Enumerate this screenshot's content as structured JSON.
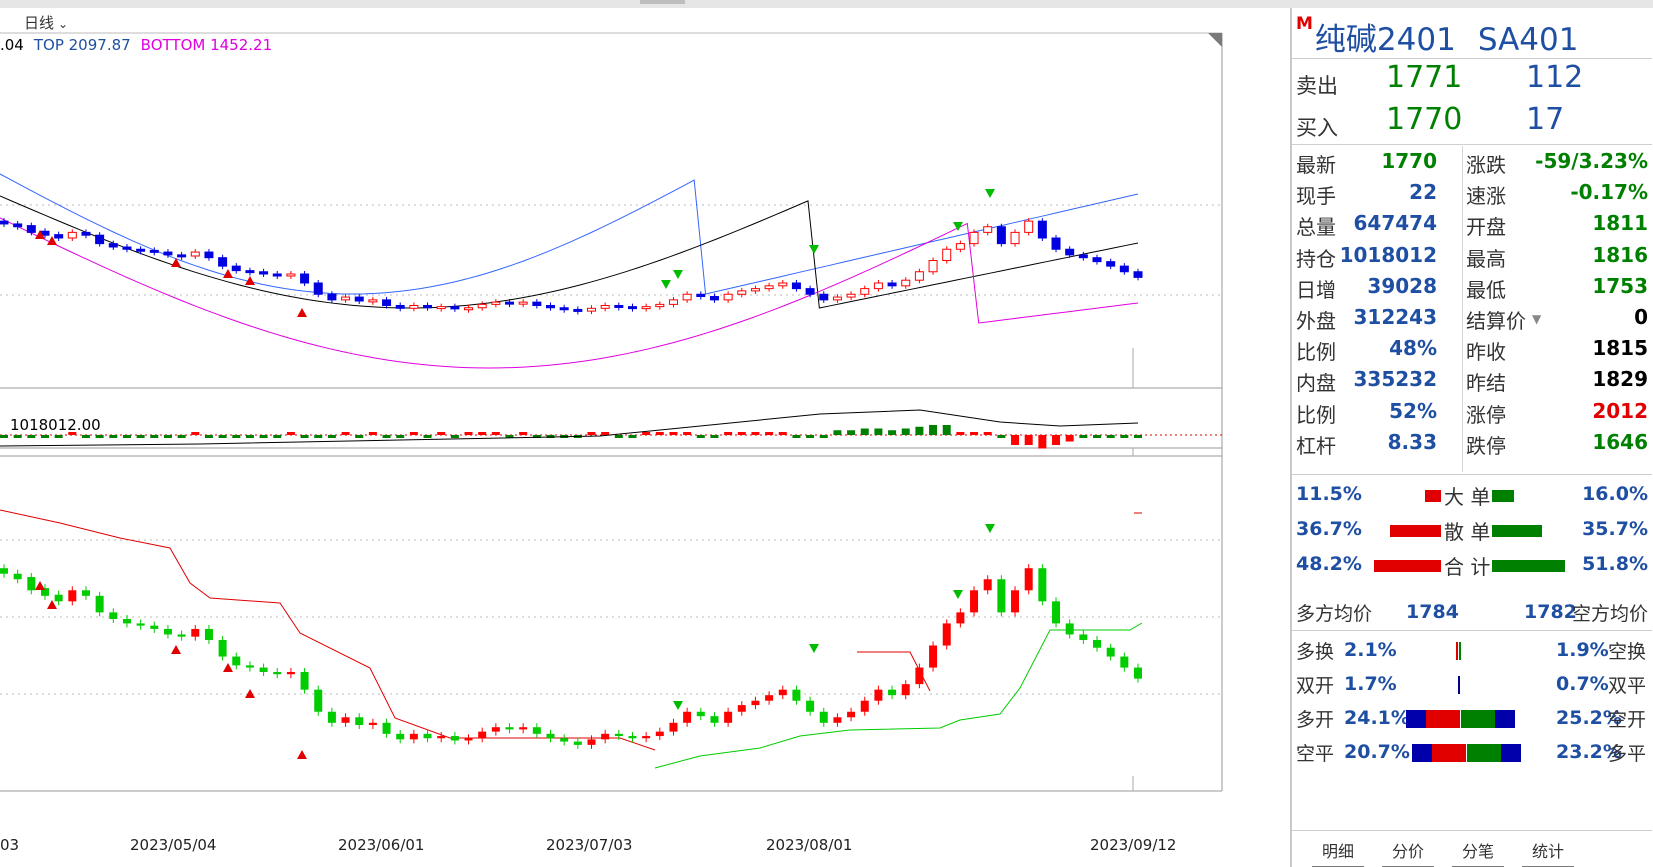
{
  "chart_header": {
    "period": "日线",
    "legend": [
      {
        "label": ".04",
        "color": "#000000"
      },
      {
        "label": "TOP 2097.87",
        "color": "#1f4fa3"
      },
      {
        "label": "BOTTOM 1452.21",
        "color": "#e000e0"
      }
    ],
    "volume_label": "1018012.00"
  },
  "x_axis_labels": [
    "03",
    "2023/05/04",
    "2023/06/01",
    "2023/07/03",
    "2023/08/01",
    "2023/09/12"
  ],
  "chart_data": [
    {
      "type": "candlestick",
      "panel": "price",
      "note_series": [
        "upper band",
        "middle band",
        "lower band"
      ],
      "candles_open_close": [
        [
          1930,
          1925
        ],
        [
          1925,
          1920
        ],
        [
          1922,
          1910
        ],
        [
          1912,
          1905
        ],
        [
          1906,
          1900
        ],
        [
          1900,
          1910
        ],
        [
          1910,
          1905
        ],
        [
          1905,
          1890
        ],
        [
          1890,
          1884
        ],
        [
          1884,
          1880
        ],
        [
          1880,
          1878
        ],
        [
          1878,
          1875
        ],
        [
          1875,
          1870
        ],
        [
          1870,
          1868
        ],
        [
          1868,
          1875
        ],
        [
          1875,
          1865
        ],
        [
          1865,
          1850
        ],
        [
          1850,
          1842
        ],
        [
          1842,
          1840
        ],
        [
          1840,
          1836
        ],
        [
          1836,
          1834
        ],
        [
          1834,
          1836
        ],
        [
          1836,
          1820
        ],
        [
          1820,
          1800
        ],
        [
          1800,
          1790
        ],
        [
          1790,
          1795
        ],
        [
          1795,
          1788
        ],
        [
          1788,
          1790
        ],
        [
          1790,
          1780
        ],
        [
          1780,
          1775
        ],
        [
          1775,
          1780
        ],
        [
          1780,
          1776
        ],
        [
          1776,
          1778
        ],
        [
          1778,
          1774
        ],
        [
          1774,
          1776
        ],
        [
          1776,
          1782
        ],
        [
          1782,
          1786
        ],
        [
          1786,
          1784
        ],
        [
          1784,
          1786
        ],
        [
          1786,
          1780
        ],
        [
          1780,
          1776
        ],
        [
          1776,
          1773
        ],
        [
          1773,
          1770
        ],
        [
          1770,
          1775
        ],
        [
          1775,
          1780
        ],
        [
          1780,
          1778
        ],
        [
          1778,
          1776
        ],
        [
          1776,
          1778
        ],
        [
          1778,
          1782
        ],
        [
          1782,
          1790
        ],
        [
          1790,
          1800
        ],
        [
          1800,
          1796
        ],
        [
          1796,
          1790
        ],
        [
          1790,
          1800
        ],
        [
          1800,
          1806
        ],
        [
          1806,
          1810
        ],
        [
          1810,
          1815
        ],
        [
          1815,
          1820
        ],
        [
          1820,
          1810
        ],
        [
          1810,
          1800
        ],
        [
          1800,
          1790
        ],
        [
          1790,
          1795
        ],
        [
          1795,
          1800
        ],
        [
          1800,
          1810
        ],
        [
          1810,
          1820
        ],
        [
          1820,
          1815
        ],
        [
          1815,
          1825
        ],
        [
          1825,
          1840
        ],
        [
          1840,
          1860
        ],
        [
          1860,
          1880
        ],
        [
          1880,
          1890
        ],
        [
          1890,
          1910
        ],
        [
          1910,
          1920
        ],
        [
          1920,
          1890
        ],
        [
          1890,
          1910
        ],
        [
          1910,
          1930
        ],
        [
          1930,
          1900
        ],
        [
          1900,
          1880
        ],
        [
          1880,
          1870
        ],
        [
          1870,
          1865
        ],
        [
          1865,
          1858
        ],
        [
          1858,
          1850
        ],
        [
          1850,
          1840
        ],
        [
          1840,
          1830
        ]
      ]
    },
    {
      "type": "bar",
      "panel": "open-interest"
    },
    {
      "type": "candlestick",
      "panel": "indicator"
    }
  ],
  "quote": {
    "m_mark": "M",
    "name": "纯碱2401",
    "code": "SA401",
    "sell_label": "卖出",
    "sell_price": "1771",
    "sell_volume": "112",
    "buy_label": "买入",
    "buy_price": "1770",
    "buy_volume": "17"
  },
  "stats": [
    {
      "l": "最新",
      "v": "1770",
      "vc": "c-green",
      "l2": "涨跌",
      "v2": "-59/3.23%",
      "v2c": "c-green"
    },
    {
      "l": "现手",
      "v": "22",
      "vc": "c-blue",
      "l2": "速涨",
      "v2": "-0.17%",
      "v2c": "c-green"
    },
    {
      "l": "总量",
      "v": "647474",
      "vc": "c-blue",
      "l2": "开盘",
      "v2": "1811",
      "v2c": "c-green"
    },
    {
      "l": "持仓",
      "v": "1018012",
      "vc": "c-blue",
      "l2": "最高",
      "v2": "1816",
      "v2c": "c-green"
    },
    {
      "l": "日增",
      "v": "39028",
      "vc": "c-blue",
      "l2": "最低",
      "v2": "1753",
      "v2c": "c-green"
    },
    {
      "l": "外盘",
      "v": "312243",
      "vc": "c-blue",
      "l2": "结算价",
      "v2": "0",
      "v2c": "c-black"
    },
    {
      "l": "比例",
      "v": "48%",
      "vc": "c-blue",
      "l2": "昨收",
      "v2": "1815",
      "v2c": "c-black"
    },
    {
      "l": "内盘",
      "v": "335232",
      "vc": "c-blue",
      "l2": "昨结",
      "v2": "1829",
      "v2c": "c-black"
    },
    {
      "l": "比例",
      "v": "52%",
      "vc": "c-blue",
      "l2": "涨停",
      "v2": "2012",
      "v2c": "c-red"
    },
    {
      "l": "杠杆",
      "v": "8.33",
      "vc": "c-blue",
      "l2": "跌停",
      "v2": "1646",
      "v2c": "c-green"
    }
  ],
  "flows": [
    {
      "left": "11.5%",
      "label": "大 单",
      "right": "16.0%",
      "red_w": 0.115,
      "green_w": 0.16
    },
    {
      "left": "36.7%",
      "label": "散 单",
      "right": "35.7%",
      "red_w": 0.367,
      "green_w": 0.357
    },
    {
      "left": "48.2%",
      "label": "合 计",
      "right": "51.8%",
      "red_w": 0.482,
      "green_w": 0.518
    }
  ],
  "avg": {
    "long_label": "多方均价",
    "long_value": "1784",
    "short_value": "1782",
    "short_label": "空方均价"
  },
  "positions": [
    {
      "l": "多换",
      "lv": "2.1%",
      "rv": "1.9%",
      "r": "空换"
    },
    {
      "l": "双开",
      "lv": "1.7%",
      "rv": "0.7%",
      "r": "双平"
    },
    {
      "l": "多开",
      "lv": "24.1%",
      "rv": "25.2%",
      "r": "空开"
    },
    {
      "l": "空平",
      "lv": "20.7%",
      "rv": "23.2%",
      "r": "多平"
    }
  ],
  "tabs": [
    "明细",
    "分价",
    "分笔",
    "统计"
  ],
  "colors": {
    "up": "#ff0000",
    "down_price": "#0000e0",
    "down_ind": "#00cc00",
    "vol_green": "#008000",
    "mid": "#000000",
    "upper": "#3366ff",
    "lower": "#e000e0"
  }
}
